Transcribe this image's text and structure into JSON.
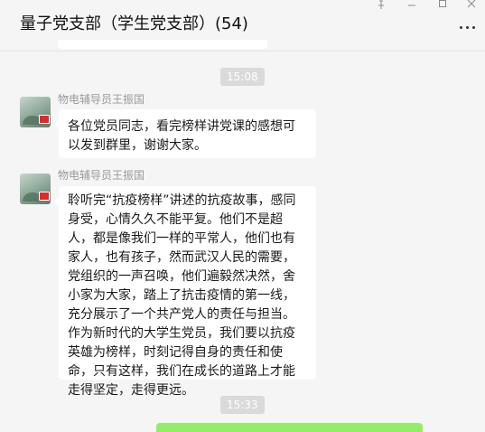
{
  "header": {
    "title": "量子党支部（学生党支部）(54)",
    "more_icon": "more-dots-icon",
    "window_controls": [
      "pin-icon",
      "minimize-icon",
      "maximize-icon",
      "close-icon"
    ]
  },
  "messages": [
    {
      "time": "15:08",
      "sender": "物电辅导员王振国",
      "text": "各位党员同志，看完榜样讲党课的感想可以发到群里，谢谢大家。"
    },
    {
      "sender": "物电辅导员王振国",
      "text": "聆听完“抗疫榜样”讲述的抗疫故事，感同身受，心情久久不能平复。他们不是超人，都是像我们一样的平常人，他们也有家人，也有孩子，然而武汉人民的需要，党组织的一声召唤，他们遍毅然决然，舍小家为大家，踏上了抗击疫情的第一线，充分展示了一个共产党人的责任与担当。作为新时代的大学生党员，我们要以抗疫英雄为榜样，时刻记得自身的责任和使命，只有这样，我们在成长的道路上才能走得坚定，走得更远。"
    },
    {
      "time": "15:33"
    }
  ],
  "colors": {
    "background": "#f5f5f5",
    "bubble_received": "#ffffff",
    "bubble_sent": "#95ec69",
    "time_chip": "#dadada"
  }
}
